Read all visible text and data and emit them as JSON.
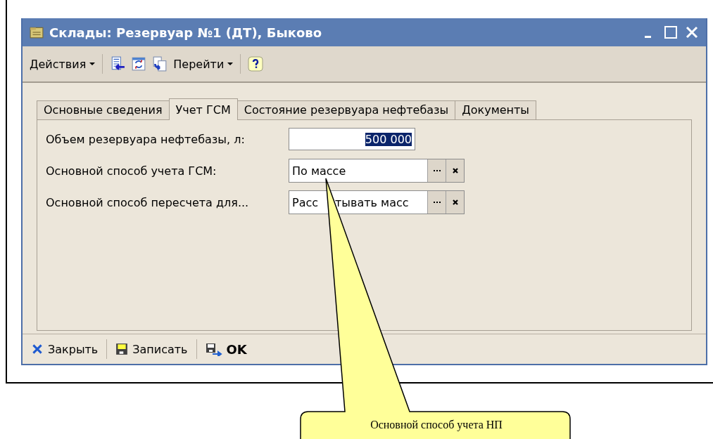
{
  "window": {
    "title": "Склады: Резервуар №1 (ДТ), Быково"
  },
  "toolbar": [
    {
      "kind": "menu",
      "label": "Действия"
    },
    {
      "kind": "icon"
    },
    {
      "kind": "icon"
    },
    {
      "kind": "icon"
    },
    {
      "kind": "menu",
      "label": "Перейти"
    },
    {
      "kind": "icon"
    }
  ],
  "tabs": [
    {
      "label": "Основные сведения",
      "selected": false
    },
    {
      "label": "Учет ГСМ",
      "selected": true
    },
    {
      "label": "Состояние резервуара нефтебазы",
      "selected": false
    },
    {
      "label": "Документы",
      "selected": false
    }
  ],
  "fields": [
    {
      "kind": "number",
      "label": "Объем резервуара нефтебазы, л:",
      "value": "500 000",
      "text_selected": true
    },
    {
      "kind": "reference",
      "label": "Основной способ учета ГСМ:",
      "value": "По массе"
    },
    {
      "kind": "reference",
      "label": "Основной способ пересчета для...",
      "value_parts": [
        "Расс",
        "тывать масс"
      ]
    }
  ],
  "bottom_buttons": [
    {
      "label": "Закрыть"
    },
    {
      "label": "Записать"
    },
    {
      "label": "OK"
    }
  ],
  "callout": {
    "text": "Основной способ учета НП"
  }
}
